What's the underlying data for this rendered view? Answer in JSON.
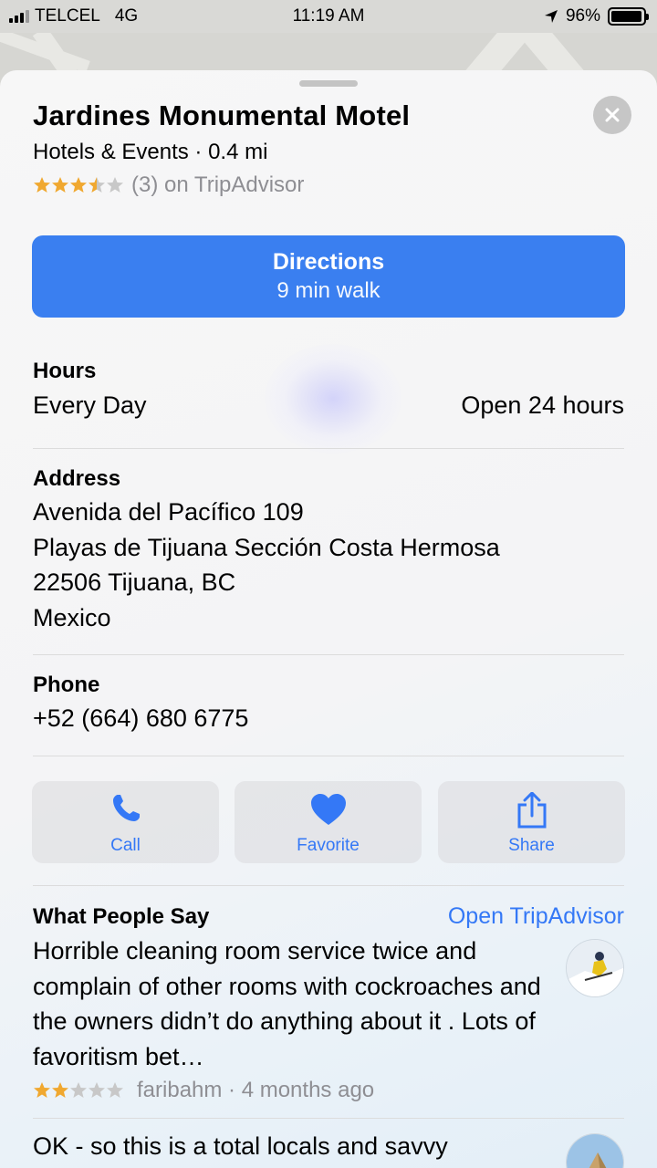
{
  "status_bar": {
    "carrier": "TELCEL",
    "network": "4G",
    "time": "11:19 AM",
    "battery": "96%",
    "battery_level": 0.96
  },
  "place": {
    "name": "Jardines Monumental Motel",
    "category_distance": "Hotels & Events · 0.4 mi",
    "rating_value": 3.5,
    "rating_text": "(3) on TripAdvisor"
  },
  "directions": {
    "label": "Directions",
    "detail": "9 min walk",
    "color": "#3a7ff0"
  },
  "hours": {
    "label": "Hours",
    "days": "Every Day",
    "value": "Open 24 hours"
  },
  "address": {
    "label": "Address",
    "lines": [
      "Avenida del Pacífico 109",
      "Playas de Tijuana Sección Costa Hermosa",
      "22506 Tijuana, BC",
      "Mexico"
    ]
  },
  "phone": {
    "label": "Phone",
    "value": "+52 (664) 680 6775"
  },
  "actions": [
    {
      "label": "Call",
      "icon": "phone-icon"
    },
    {
      "label": "Favorite",
      "icon": "heart-icon"
    },
    {
      "label": "Share",
      "icon": "share-icon"
    }
  ],
  "reviews": {
    "heading": "What People Say",
    "link": "Open TripAdvisor",
    "items": [
      {
        "text": "Horrible cleaning room service twice and complain of other rooms with cockroaches and the owners didn’t do anything about it . Lots of favoritism bet…",
        "rating": 2,
        "author_time": "faribahm · 4 months ago"
      },
      {
        "text": "OK - so this is a total locals and savvy"
      }
    ]
  },
  "colors": {
    "accent": "#3478f6",
    "star": "#f0a830"
  }
}
